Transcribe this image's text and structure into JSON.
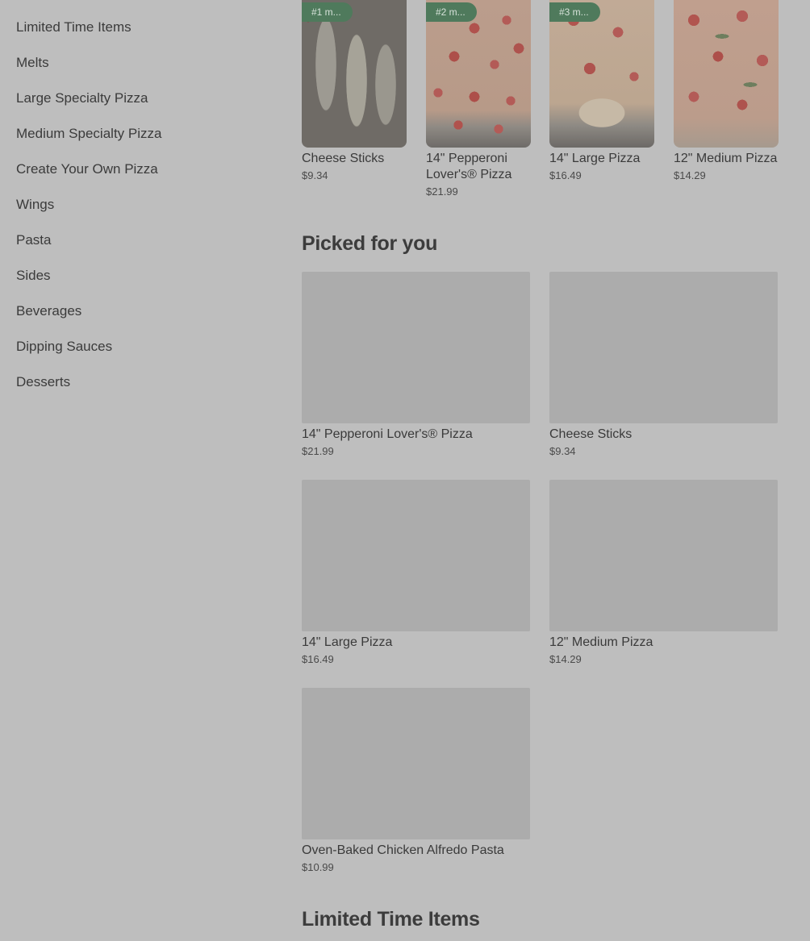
{
  "sidebar": {
    "items": [
      {
        "label": "Limited Time Items"
      },
      {
        "label": "Melts"
      },
      {
        "label": "Large Specialty Pizza"
      },
      {
        "label": "Medium Specialty Pizza"
      },
      {
        "label": "Create Your Own Pizza"
      },
      {
        "label": "Wings"
      },
      {
        "label": "Pasta"
      },
      {
        "label": "Sides"
      },
      {
        "label": "Beverages"
      },
      {
        "label": "Dipping Sauces"
      },
      {
        "label": "Desserts"
      }
    ]
  },
  "popular": {
    "items": [
      {
        "badge": "#1 m...",
        "name": "Cheese Sticks",
        "price": "$9.34"
      },
      {
        "badge": "#2 m...",
        "name": "14\" Pepperoni Lover's® Pizza",
        "price": "$21.99"
      },
      {
        "badge": "#3 m...",
        "name": "14\" Large Pizza",
        "price": "$16.49"
      },
      {
        "badge": "",
        "name": "12\" Medium Pizza",
        "price": "$14.29"
      }
    ]
  },
  "picked": {
    "title": "Picked for you",
    "items": [
      {
        "name": "14\" Pepperoni Lover's® Pizza",
        "price": "$21.99"
      },
      {
        "name": "Cheese Sticks",
        "price": "$9.34"
      },
      {
        "name": "14\" Large Pizza",
        "price": "$16.49"
      },
      {
        "name": "12\" Medium Pizza",
        "price": "$14.29"
      },
      {
        "name": "Oven-Baked Chicken Alfredo Pasta",
        "price": "$10.99"
      }
    ]
  },
  "next_section": {
    "title": "Limited Time Items"
  },
  "colors": {
    "overlay_bg": "#bebebe",
    "badge_bg": "#4f7a5c",
    "placeholder": "#acacac"
  }
}
